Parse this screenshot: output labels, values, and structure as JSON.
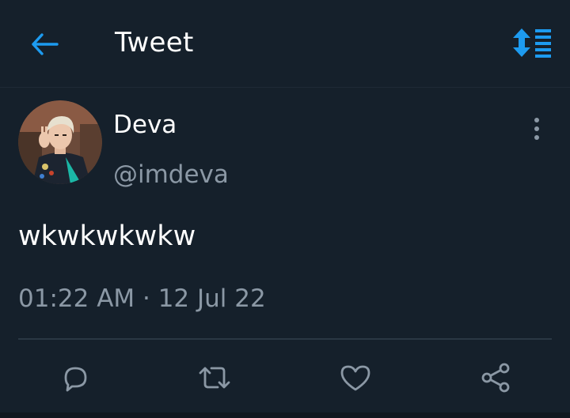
{
  "header": {
    "title": "Tweet",
    "back_icon": "arrow-left-icon",
    "sort_icon": "sort-lines-icon"
  },
  "tweet": {
    "display_name": "Deva",
    "handle": "@imdeva",
    "text": "wkwkwkwkw",
    "timestamp": "01:22 AM · 12 Jul 22"
  },
  "actions": [
    {
      "name": "reply",
      "icon": "comment-icon"
    },
    {
      "name": "retweet",
      "icon": "retweet-icon"
    },
    {
      "name": "like",
      "icon": "heart-icon"
    },
    {
      "name": "share",
      "icon": "share-icon"
    }
  ],
  "colors": {
    "background": "#15202b",
    "accent": "#1d9bf0",
    "secondary_text": "#8b98a5",
    "divider": "#2a3744"
  }
}
